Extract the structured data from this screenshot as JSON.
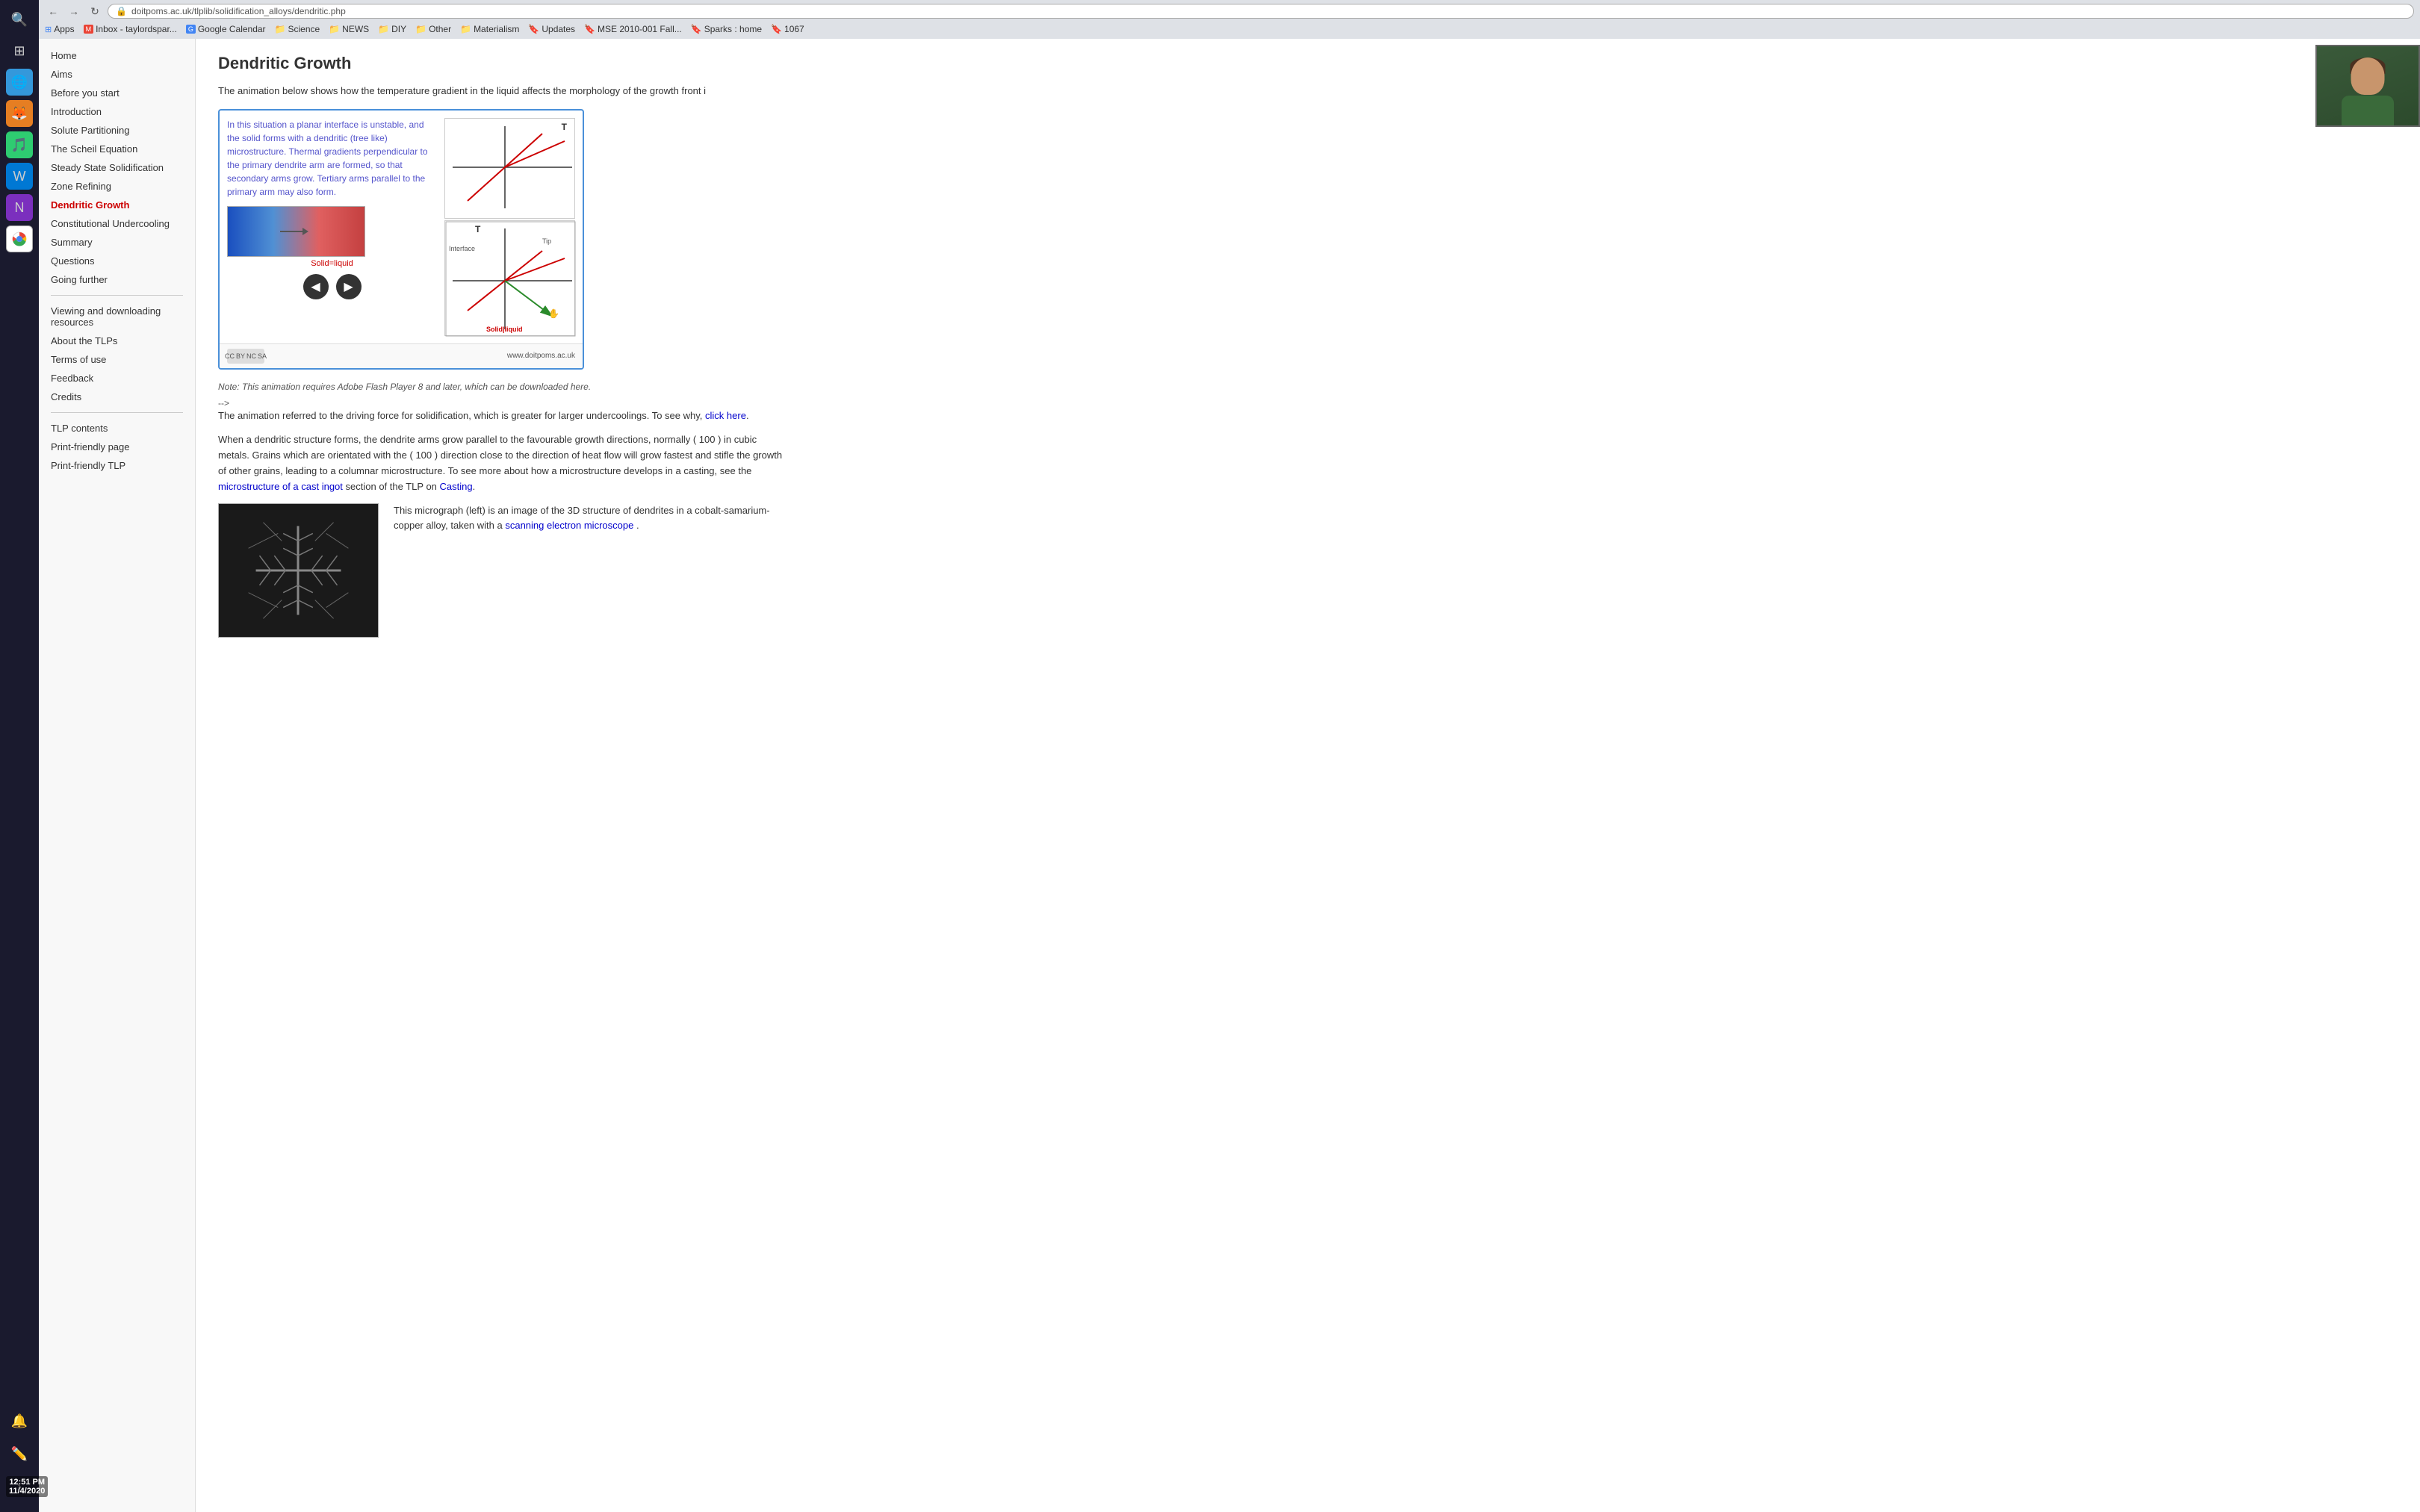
{
  "browser": {
    "url": "doitpoms.ac.uk/tlplib/solidification_alloys/dendritic.php",
    "back_btn": "←",
    "forward_btn": "→",
    "refresh_btn": "↻"
  },
  "bookmarks": [
    {
      "label": "Apps",
      "color": "#4285F4"
    },
    {
      "label": "Inbox - taylordspar...",
      "color": "#EA4335"
    },
    {
      "label": "Google Calendar",
      "color": "#4285F4"
    },
    {
      "label": "Science",
      "color": "#5f6368"
    },
    {
      "label": "NEWS",
      "color": "#5f6368"
    },
    {
      "label": "DIY",
      "color": "#5f6368"
    },
    {
      "label": "Other",
      "color": "#5f6368"
    },
    {
      "label": "Materialism",
      "color": "#5f6368"
    },
    {
      "label": "Updates",
      "color": "#5f6368"
    },
    {
      "label": "MSE 2010-001 Fall...",
      "color": "#5f6368"
    },
    {
      "label": "Sparks : home",
      "color": "#5f6368"
    },
    {
      "label": "1067",
      "color": "#5f6368"
    }
  ],
  "nav": {
    "items": [
      {
        "label": "Home",
        "active": false
      },
      {
        "label": "Aims",
        "active": false
      },
      {
        "label": "Before you start",
        "active": false
      },
      {
        "label": "Introduction",
        "active": false
      },
      {
        "label": "Solute Partitioning",
        "active": false
      },
      {
        "label": "The Scheil Equation",
        "active": false
      },
      {
        "label": "Steady State Solidification",
        "active": false
      },
      {
        "label": "Zone Refining",
        "active": false
      },
      {
        "label": "Dendritic Growth",
        "active": true
      },
      {
        "label": "Constitutional Undercooling",
        "active": false
      },
      {
        "label": "Summary",
        "active": false
      },
      {
        "label": "Questions",
        "active": false
      },
      {
        "label": "Going further",
        "active": false
      }
    ],
    "secondary": [
      {
        "label": "Viewing and downloading resources"
      },
      {
        "label": "About the TLPs"
      },
      {
        "label": "Terms of use"
      },
      {
        "label": "Feedback"
      },
      {
        "label": "Credits"
      }
    ],
    "tertiary": [
      {
        "label": "TLP contents"
      },
      {
        "label": "Print-friendly page"
      },
      {
        "label": "Print-friendly TLP"
      }
    ]
  },
  "page": {
    "title": "Dendritic Growth",
    "intro": "The animation below shows how the temperature gradient in the liquid affects the morphology of the growth front i",
    "anim_text": "In this situation a planar interface is unstable, and the solid forms with a dendritic (tree like) microstructure. Thermal gradients perpendicular to the primary dendrite arm are formed, so that secondary arms grow. Tertiary arms parallel to the primary arm may also form.",
    "solid_liquid_label": "Solid=liquid",
    "interface_label": "Interface",
    "tip_label": "Tip",
    "solid_liquid_bottom": "Solid|liquid",
    "site_url": "www.doitpoms.ac.uk",
    "note": "Note: This animation requires Adobe Flash Player 8 and later, which can be downloaded here.",
    "arrow_text": "-->",
    "para1": "The animation referred to the driving force for solidification, which is greater for larger undercoolings. To see why, click here.",
    "para2": "When a dendritic structure forms, the dendrite arms grow parallel to the favourable growth directions, normally ⟨ 100 ⟩ in cubic metals. Grains which are orientated with the ⟨ 100 ⟩ direction close to the direction of heat flow will grow fastest and stifle the growth of other grains, leading to a columnar microstructure. To see more about how a microstructure develops in a casting, see the microstructure of a cast ingot section of the TLP on Casting.",
    "micrograph_caption": "This micrograph (left) is an image of the 3D structure of dendrites in a cobalt-samarium-copper alloy, taken with a scanning electron microscope ."
  },
  "time": "12:51 PM\n11/4/2020"
}
